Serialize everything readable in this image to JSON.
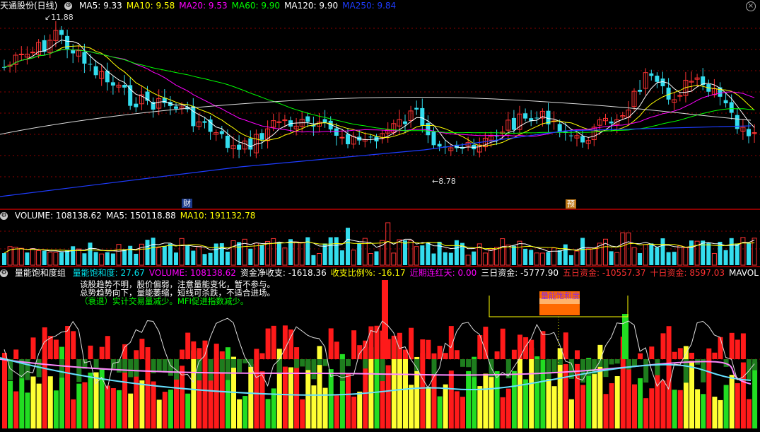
{
  "price_panel": {
    "title": "天通股份(日线)",
    "indicators": [
      {
        "label": "MA5: 9.33",
        "color": "#ffffff"
      },
      {
        "label": "MA10: 9.58",
        "color": "#ffff00"
      },
      {
        "label": "MA20: 9.53",
        "color": "#ff00ff"
      },
      {
        "label": "MA60: 9.90",
        "color": "#00ff00"
      },
      {
        "label": "MA120: 9.90",
        "color": "#ffffff"
      },
      {
        "label": "MA250: 9.84",
        "color": "#1e3cff"
      }
    ],
    "high_label": "11.88",
    "low_label": "8.78",
    "tag_fin": "财",
    "tag_pre": "预"
  },
  "volume_panel": {
    "indicators": [
      {
        "label": "VOLUME: 108138.62",
        "color": "#ffffff"
      },
      {
        "label": "MA5: 150118.88",
        "color": "#ffffff"
      },
      {
        "label": "MA10: 191132.78",
        "color": "#ffff00"
      }
    ]
  },
  "lower_panel": {
    "title": "量能饱和度组",
    "indicators": [
      {
        "label": "量能饱和度: 27.67",
        "color": "#00e5ee"
      },
      {
        "label": "VOLUME: 108138.62",
        "color": "#ff00ff"
      },
      {
        "label": "资金净收支: -1618.36",
        "color": "#ffffff"
      },
      {
        "label": "收支比例%: -16.17",
        "color": "#ffff00"
      },
      {
        "label": "近期连红天: 0.00",
        "color": "#ff00ff"
      },
      {
        "label": "三日资金: -5777.90",
        "color": "#ffffff"
      },
      {
        "label": "五日资金: -10557.37",
        "color": "#ff3030"
      },
      {
        "label": "十日资金: 8597.03",
        "color": "#ff3030"
      },
      {
        "label": "MAVOL",
        "color": "#ffffff"
      }
    ],
    "notes": [
      {
        "text": "该股趋势不明，股价偏弱，注意量能变化，暂不参与。",
        "color": "#ffffff"
      },
      {
        "text": "总势趋势向下，量能萎缩，短线可杀跌，不适合进场。",
        "color": "#ffffff"
      },
      {
        "text": "（衰退）实计交易量减少。MFI促进指数减少。",
        "color": "#00ff00"
      }
    ],
    "badge": "量能饱和度"
  },
  "colors": {
    "up": "#ff3333",
    "down": "#33ddee",
    "grid": "#8b0000"
  }
}
